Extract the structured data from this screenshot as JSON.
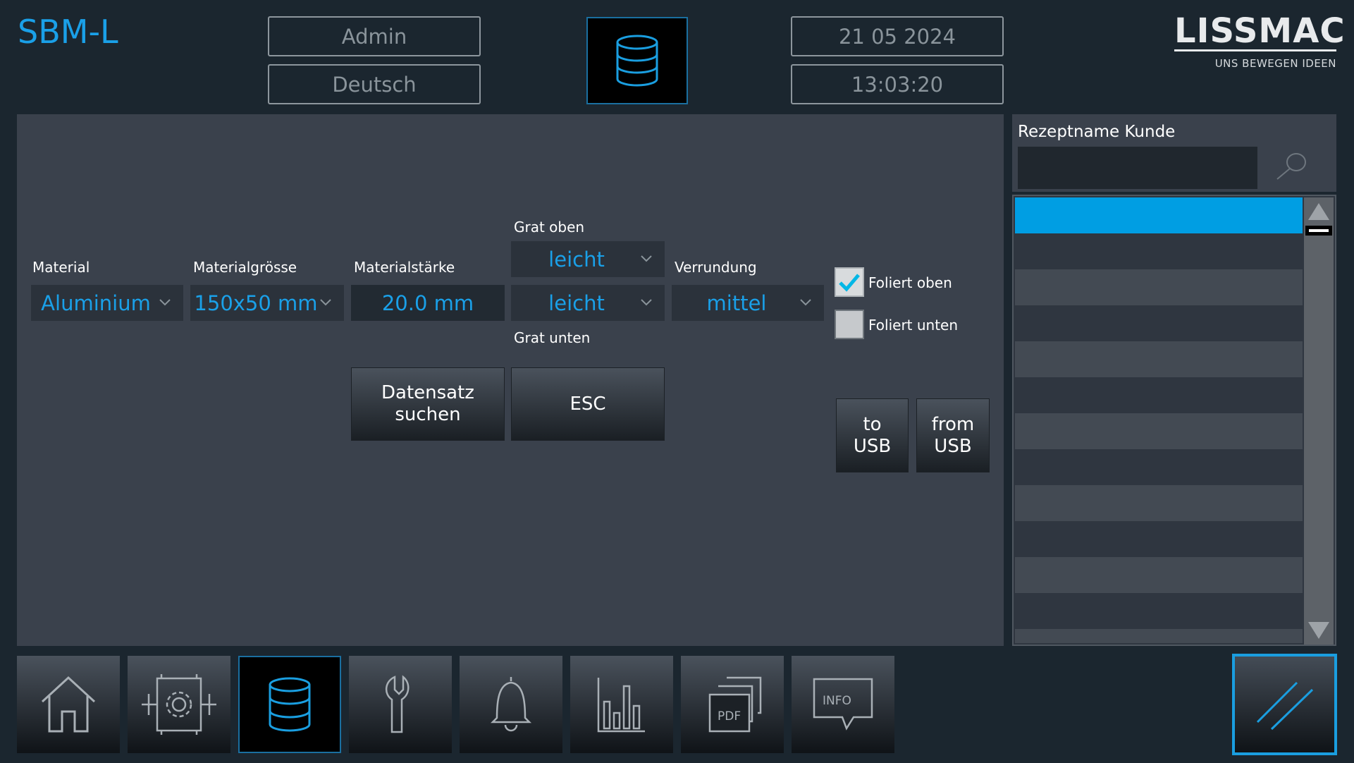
{
  "header": {
    "app_title": "SBM-L",
    "user": "Admin",
    "language": "Deutsch",
    "date": "21 05 2024",
    "time": "13:03:20",
    "logo_text": "LISSMAC",
    "logo_subtitle": "UNS BEWEGEN IDEEN"
  },
  "form": {
    "material": {
      "label": "Material",
      "value": "Aluminium"
    },
    "material_size": {
      "label": "Materialgrösse",
      "value": "150x50 mm"
    },
    "material_thickness": {
      "label": "Materialstärke",
      "value": "20.0 mm"
    },
    "burr_top": {
      "label": "Grat oben",
      "value": "leicht"
    },
    "burr_bottom": {
      "label": "Grat unten",
      "value": "leicht"
    },
    "rounding": {
      "label": "Verrundung",
      "value": "mittel"
    },
    "foil_top": {
      "label": "Foliert oben",
      "checked": true
    },
    "foil_bottom": {
      "label": "Foliert unten",
      "checked": false
    },
    "search_record_line1": "Datensatz",
    "search_record_line2": "suchen",
    "esc_label": "ESC",
    "to_usb_line1": "to",
    "to_usb_line2": "USB",
    "from_usb_line1": "from",
    "from_usb_line2": "USB"
  },
  "recipe_panel": {
    "title": "Rezeptname Kunde",
    "search_value": "",
    "selected_row_color": "#009ee3"
  },
  "nav": {
    "items": [
      "home-icon",
      "machine-settings-icon",
      "database-icon",
      "wrench-icon",
      "bell-icon",
      "bar-chart-icon",
      "pdf-documents-icon",
      "info-icon"
    ],
    "pdf_label": "PDF",
    "info_label": "INFO"
  },
  "colors": {
    "accent": "#1aa0e8",
    "background": "#1b262f",
    "panel": "#3a414c"
  }
}
